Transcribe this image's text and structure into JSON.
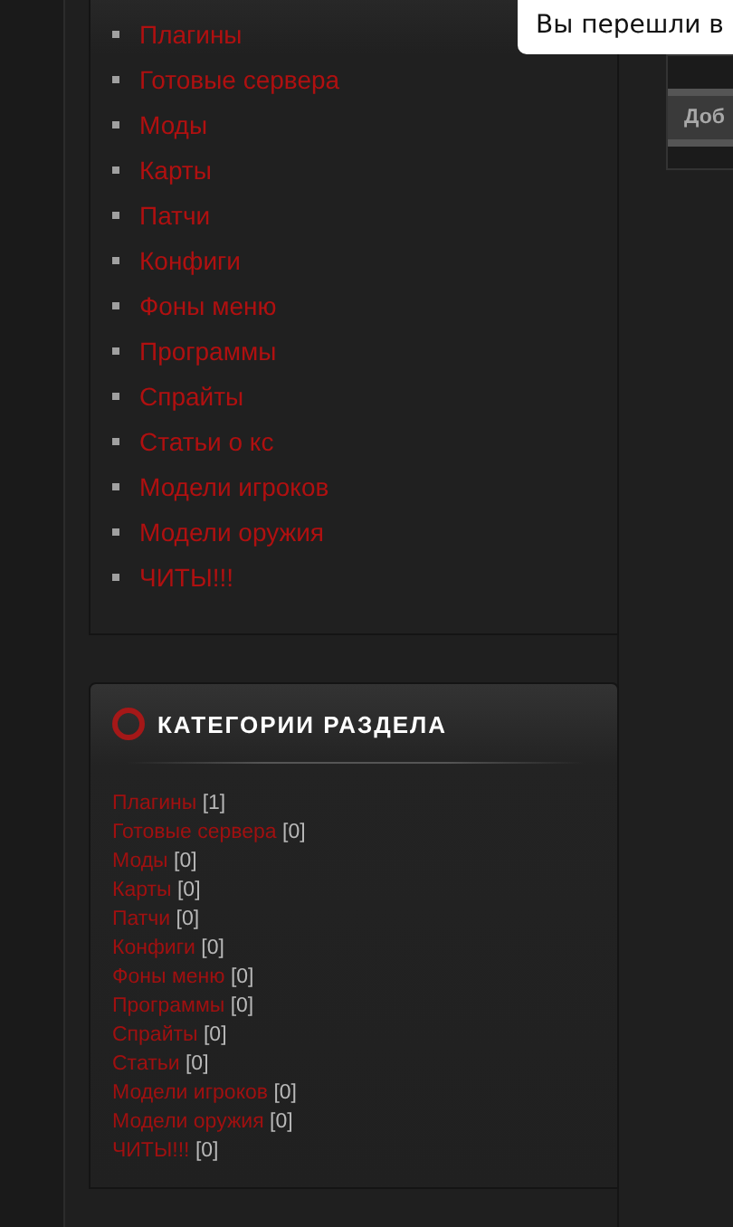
{
  "tooltip": {
    "text": "Вы перешли в"
  },
  "side_widget": {
    "button": "Доб"
  },
  "menu": {
    "items": [
      {
        "label": "Плагины"
      },
      {
        "label": "Готовые сервера"
      },
      {
        "label": "Моды"
      },
      {
        "label": "Карты"
      },
      {
        "label": "Патчи"
      },
      {
        "label": "Конфиги"
      },
      {
        "label": "Фоны меню"
      },
      {
        "label": "Программы"
      },
      {
        "label": "Спрайты"
      },
      {
        "label": "Статьи о кс"
      },
      {
        "label": "Модели игроков"
      },
      {
        "label": "Модели оружия"
      },
      {
        "label": "ЧИТЫ!!!"
      }
    ]
  },
  "categories": {
    "title": "КАТЕГОРИИ РАЗДЕЛА",
    "items": [
      {
        "label": "Плагины",
        "count": "[1]"
      },
      {
        "label": "Готовые сервера",
        "count": "[0]"
      },
      {
        "label": "Моды",
        "count": "[0]"
      },
      {
        "label": "Карты",
        "count": "[0]"
      },
      {
        "label": "Патчи",
        "count": "[0]"
      },
      {
        "label": "Конфиги",
        "count": "[0]"
      },
      {
        "label": "Фоны меню",
        "count": "[0]"
      },
      {
        "label": "Программы",
        "count": "[0]"
      },
      {
        "label": "Спрайты",
        "count": "[0]"
      },
      {
        "label": "Статьи",
        "count": "[0]"
      },
      {
        "label": "Модели игроков",
        "count": "[0]"
      },
      {
        "label": "Модели оружия",
        "count": "[0]"
      },
      {
        "label": "ЧИТЫ!!!",
        "count": "[0]"
      }
    ]
  }
}
